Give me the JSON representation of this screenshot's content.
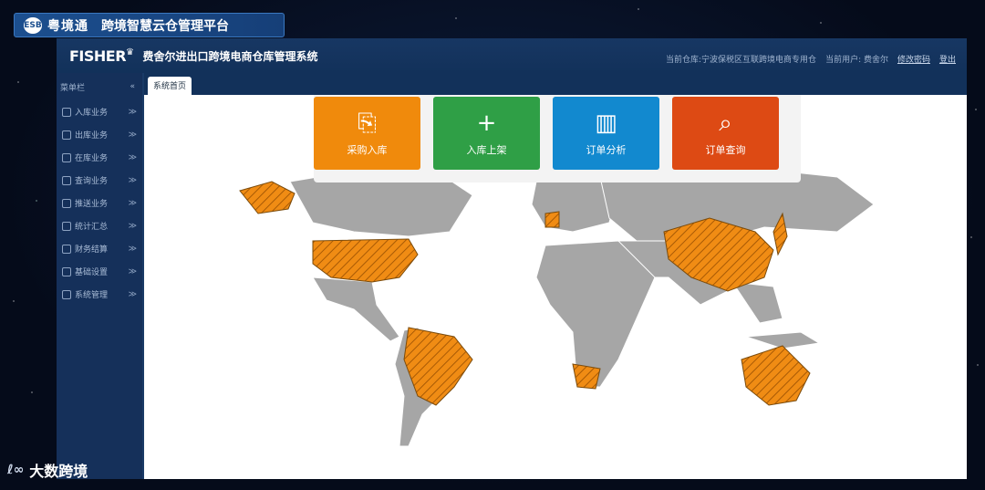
{
  "platform": {
    "logo_text": "ESB",
    "brand": "粤境通",
    "title": "跨境智慧云仓管理平台"
  },
  "header": {
    "logo": "FISHER",
    "title": "费舍尔进出口跨境电商仓库管理系统",
    "current_warehouse": "当前仓库:宁波保税区互联跨境电商专用仓",
    "current_user": "当前用户: 费舍尔",
    "change_password": "修改密码",
    "logout": "登出"
  },
  "sidebar": {
    "title": "菜单栏",
    "collapse_icon": "«",
    "items": [
      {
        "label": "入库业务",
        "icon": "inbound-icon"
      },
      {
        "label": "出库业务",
        "icon": "outbound-icon"
      },
      {
        "label": "在库业务",
        "icon": "warehouse-icon"
      },
      {
        "label": "查询业务",
        "icon": "query-icon"
      },
      {
        "label": "推送业务",
        "icon": "push-icon"
      },
      {
        "label": "统计汇总",
        "icon": "pie-chart-icon"
      },
      {
        "label": "财务结算",
        "icon": "finance-icon"
      },
      {
        "label": "基础设置",
        "icon": "settings-icon"
      },
      {
        "label": "系统管理",
        "icon": "user-admin-icon"
      }
    ]
  },
  "tabs": [
    {
      "label": "系统首页"
    }
  ],
  "quick_actions": [
    {
      "label": "采购入库",
      "icon": "purchase-inbound-icon",
      "color": "#f08a0c"
    },
    {
      "label": "入库上架",
      "icon": "plus-icon",
      "color": "#2f9f46"
    },
    {
      "label": "订单分析",
      "icon": "bar-chart-icon",
      "color": "#1289cf"
    },
    {
      "label": "订单查询",
      "icon": "search-document-icon",
      "color": "#dd4a14"
    }
  ],
  "map": {
    "land_color": "#a6a6a6",
    "highlight_color": "#f08c14",
    "highlighted_regions": [
      "Alaska",
      "United States",
      "Brazil",
      "China",
      "Japan",
      "Australia",
      "South Africa",
      "France"
    ]
  },
  "watermark": {
    "text": "大数跨境",
    "mark": "ℓ∞"
  }
}
